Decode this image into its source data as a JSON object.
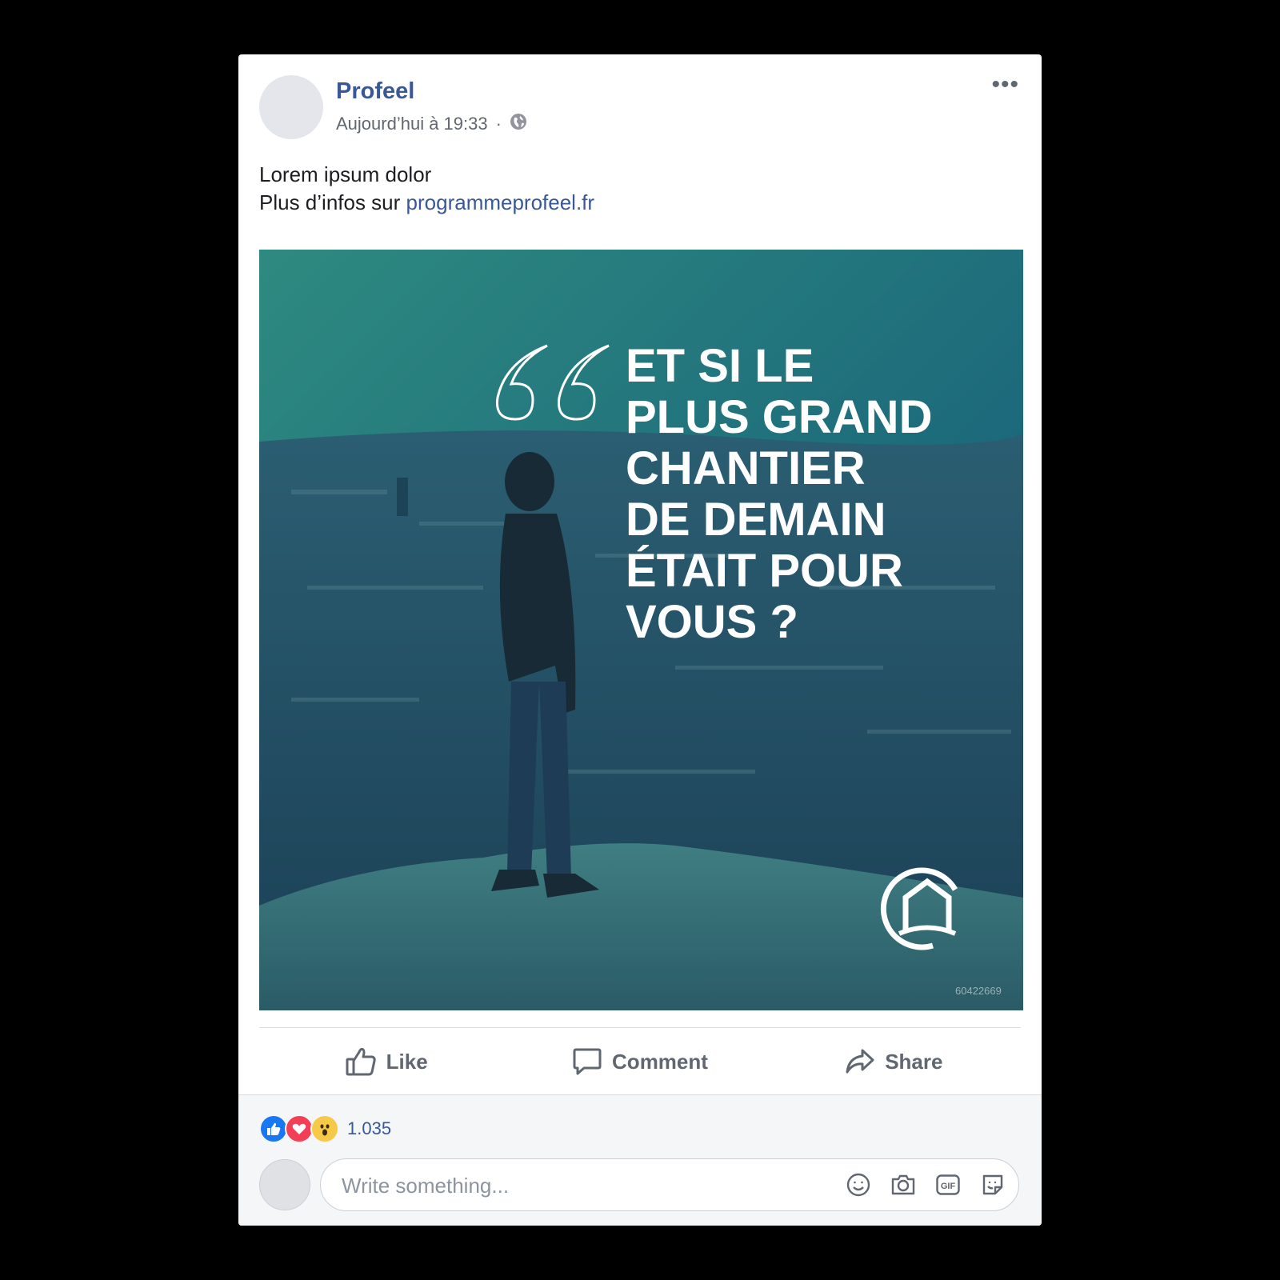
{
  "post": {
    "page_name": "Profeel",
    "timestamp": "Aujourd’hui à 19:33",
    "separator": "·",
    "privacy_icon": "globe-icon",
    "more_label": "•••",
    "text_line1": "Lorem ipsum dolor",
    "text_line2_prefix": "Plus d’infos sur ",
    "link": "programmeprofeel.fr"
  },
  "image": {
    "quote_lines": [
      "ET SI LE",
      "PLUS GRAND",
      "CHANTIER",
      "DE DEMAIN",
      "ÉTAIT POUR",
      "VOUS ?"
    ],
    "watermark": "60422669",
    "logo_icon": "house-logo-icon"
  },
  "actions": {
    "like": "Like",
    "comment": "Comment",
    "share": "Share"
  },
  "reactions": {
    "icons": [
      "like-reaction-icon",
      "love-reaction-icon",
      "wow-reaction-icon"
    ],
    "count": "1.035"
  },
  "comment": {
    "placeholder": "Write something...",
    "icons": [
      "emoji-icon",
      "camera-icon",
      "gif-icon",
      "sticker-icon"
    ]
  },
  "colors": {
    "link": "#385898",
    "like": "#1877f2",
    "love": "#f33e58",
    "wow": "#f7c948",
    "photo_tint": "#1f6a74"
  }
}
